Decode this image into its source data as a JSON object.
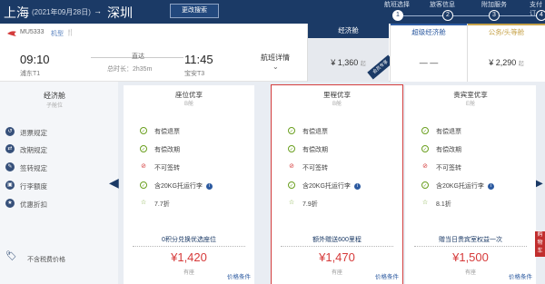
{
  "header": {
    "from_city": "上海",
    "date": "(2021年09月28日)",
    "arrow": "→",
    "to_city": "深圳",
    "change_search": "更改搜索",
    "steps": [
      {
        "num": "1",
        "label": "航班选择"
      },
      {
        "num": "2",
        "label": "旅客信息"
      },
      {
        "num": "3",
        "label": "附加服务"
      },
      {
        "num": "4",
        "label": "支付订"
      }
    ]
  },
  "flight": {
    "flight_no": "MU5333",
    "aircraft": "机型",
    "meal_icon": "🍴",
    "dep_time": "09:10",
    "dep_airport": "浦东T1",
    "arr_time": "11:45",
    "arr_airport": "宝安T3",
    "direct": "直达",
    "duration": "总时长：2h35m",
    "detail": "航班详情",
    "detail_chev": "⌄"
  },
  "cabins": [
    {
      "name": "经济舱",
      "price": "¥ 1,360",
      "unit": "起",
      "ribbon": "会员专享"
    },
    {
      "name": "超级经济舱",
      "price": "— —",
      "unit": ""
    },
    {
      "name": "公务/头等舱",
      "price": "¥ 2,290",
      "unit": "起"
    }
  ],
  "labels": {
    "title": "经济舱",
    "subtitle": "子舱位",
    "rows": [
      {
        "icon": "↺",
        "text": "退票规定"
      },
      {
        "icon": "⇄",
        "text": "改期规定"
      },
      {
        "icon": "✎",
        "text": "签转规定"
      },
      {
        "icon": "▣",
        "text": "行李额度"
      },
      {
        "icon": "★",
        "text": "优惠折扣"
      }
    ],
    "tax_label": "不含税费价格",
    "tax_icon": "🏷"
  },
  "products": [
    {
      "title": "座位优享",
      "sub": "B舱",
      "refund": "有偿退票",
      "change": "有偿改期",
      "endorse": "不可签转",
      "baggage": "含20KG托运行李",
      "discount": "7.7折",
      "promo": "0积分兑换优选座位",
      "price": "¥1,420",
      "seat": "有座",
      "cond": "价格条件"
    },
    {
      "title": "里程优享",
      "sub": "B舱",
      "refund": "有偿退票",
      "change": "有偿改期",
      "endorse": "不可签转",
      "baggage": "含20KG托运行李",
      "discount": "7.9折",
      "promo": "额外赠送600里程",
      "price": "¥1,470",
      "seat": "有座",
      "cond": "价格条件"
    },
    {
      "title": "贵宾室优享",
      "sub": "E舱",
      "refund": "有偿退票",
      "change": "有偿改期",
      "endorse": "不可签转",
      "baggage": "含20KG托运行李",
      "discount": "8.1折",
      "promo": "赠当日贵宾室权益一次",
      "price": "¥1,500",
      "seat": "有座",
      "cond": "价格条件"
    }
  ],
  "nav": {
    "prev": "◀",
    "next": "▶"
  },
  "side_tab": "购物车",
  "colors": {
    "brand": "#1b3a66",
    "price": "#d63a3a",
    "accent_blue": "#2c5aa0",
    "gold": "#c7a34a"
  }
}
